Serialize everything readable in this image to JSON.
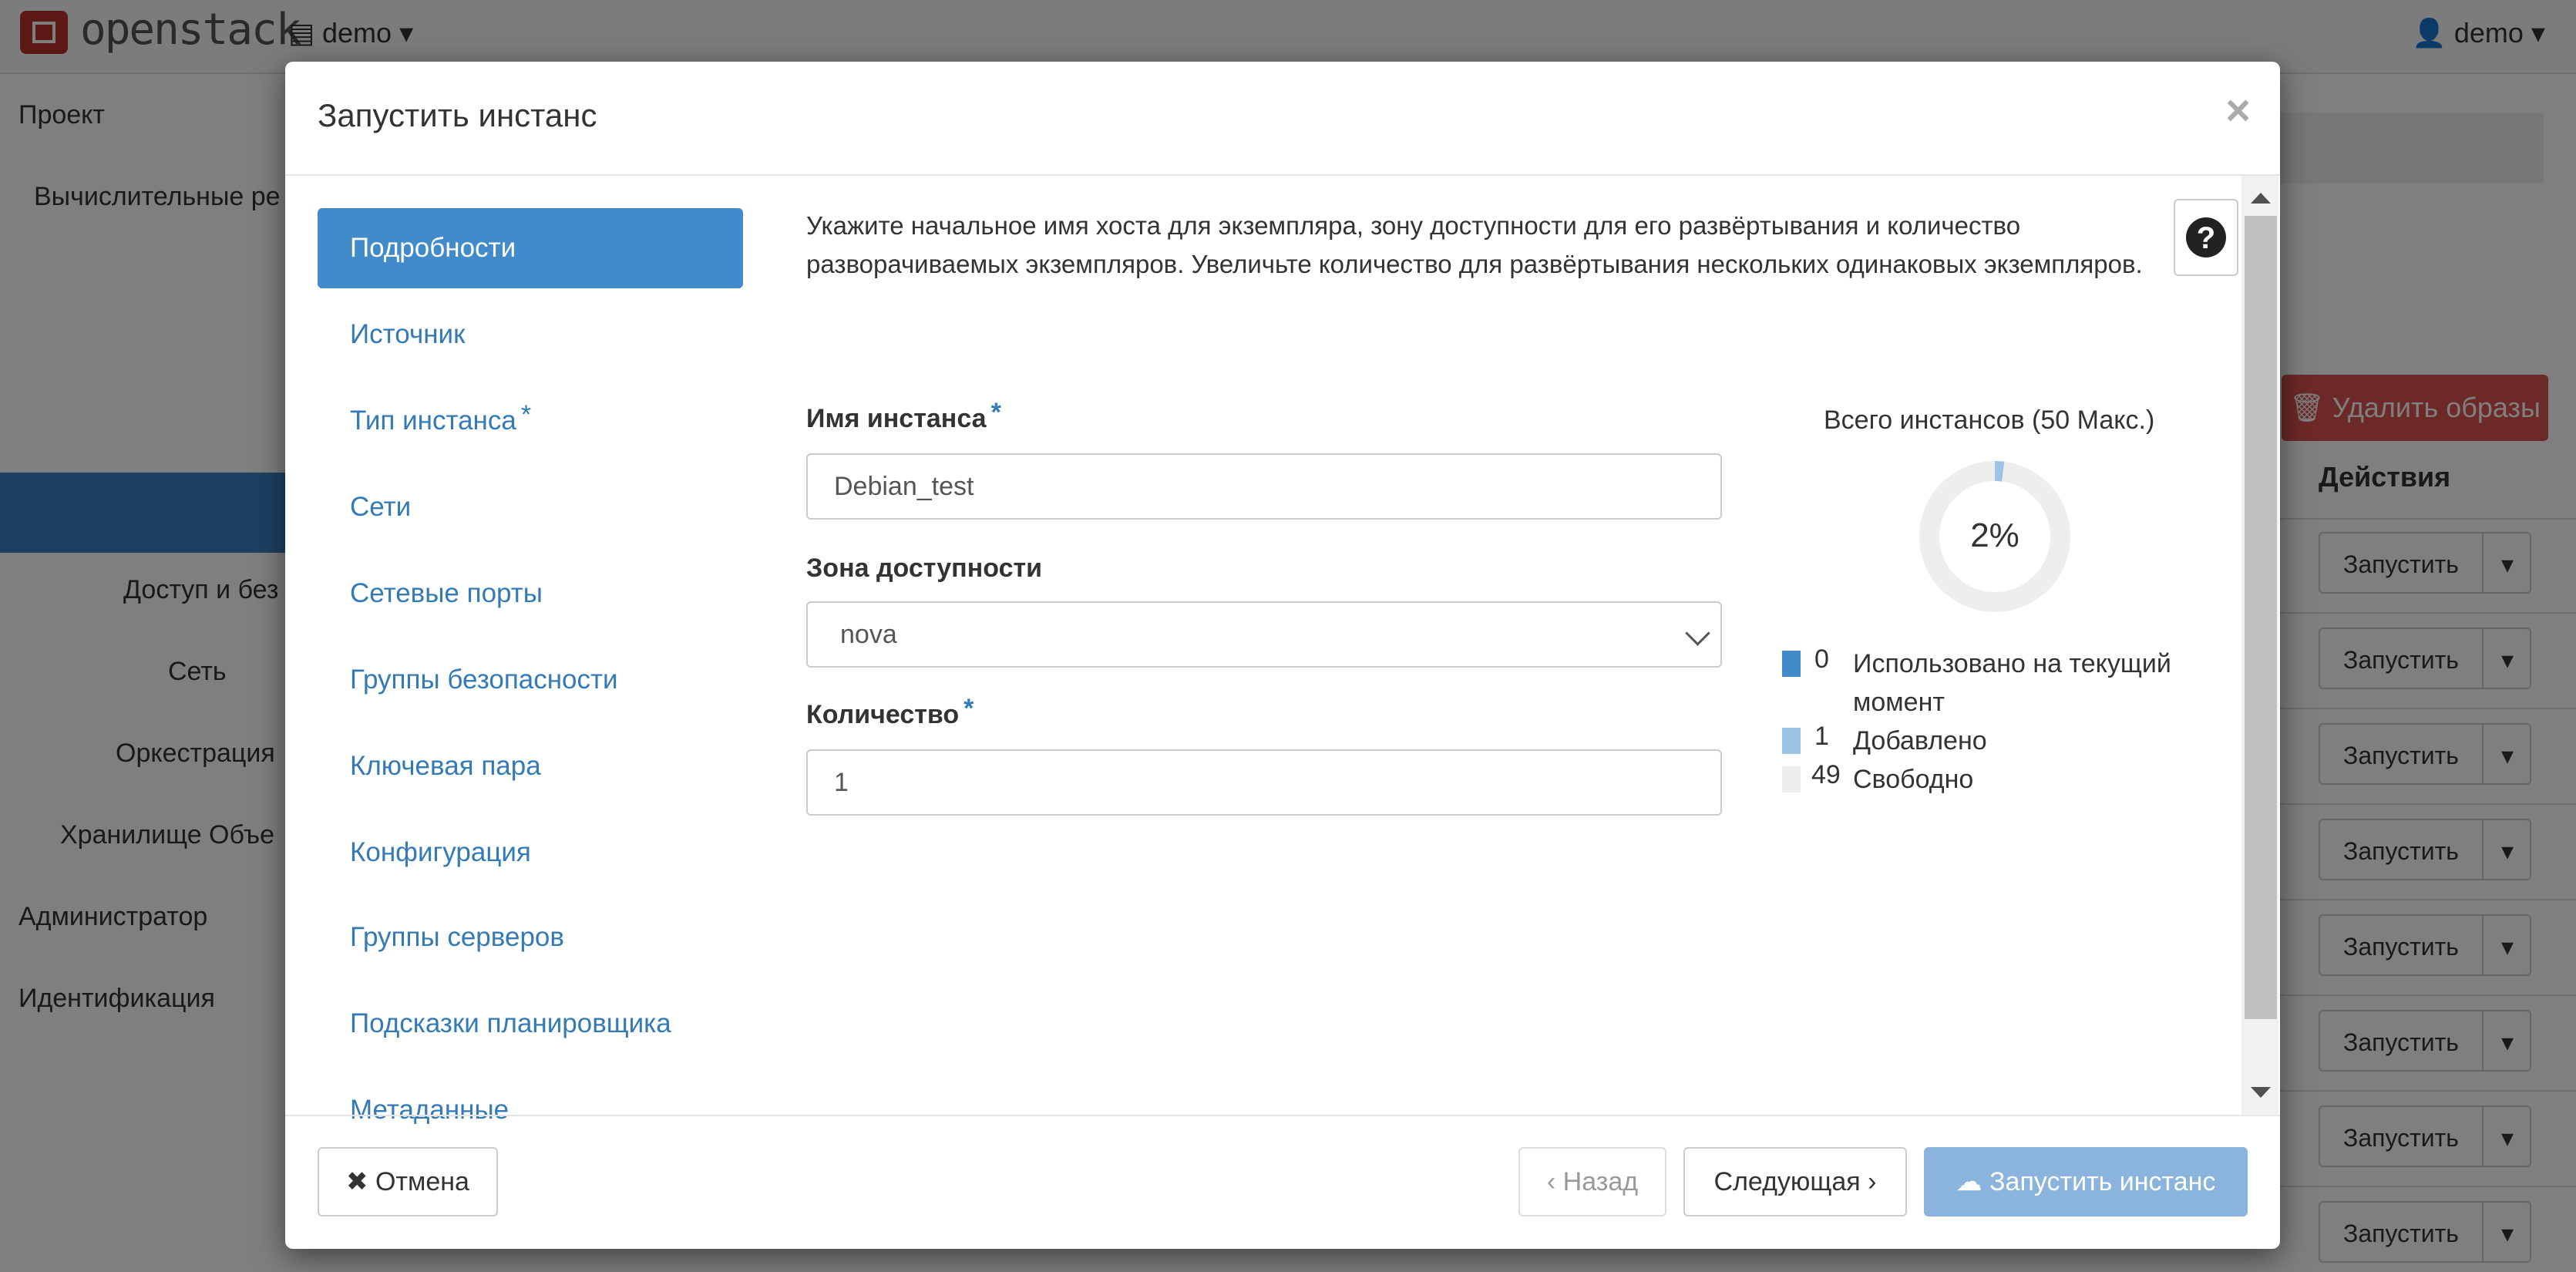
{
  "topbar": {
    "logo_text": "openstack",
    "project": "demo",
    "user": "demo"
  },
  "sidebar": {
    "items": [
      "Проект",
      "Вычислительные ре",
      "Доступ и без",
      "Сеть",
      "Оркестрация",
      "Хранилище Объе",
      "Администратор",
      "Идентификация"
    ]
  },
  "background": {
    "delete_button": "Удалить образы",
    "actions_header": "Действия",
    "row_action": "Запустить"
  },
  "modal": {
    "title": "Запустить инстанс",
    "close": "×",
    "nav": [
      {
        "label": "Подробности",
        "required": false,
        "active": true
      },
      {
        "label": "Источник",
        "required": false
      },
      {
        "label": "Тип инстанса",
        "required": true
      },
      {
        "label": "Сети",
        "required": false
      },
      {
        "label": "Сетевые порты",
        "required": false
      },
      {
        "label": "Группы безопасности",
        "required": false
      },
      {
        "label": "Ключевая пара",
        "required": false
      },
      {
        "label": "Конфигурация",
        "required": false
      },
      {
        "label": "Группы серверов",
        "required": false
      },
      {
        "label": "Подсказки планировщика",
        "required": false
      },
      {
        "label": "Метаданные",
        "required": false
      }
    ],
    "required_mark": "*",
    "description": "Укажите начальное имя хоста для экземпляра, зону доступности для его развёртывания и количество разворачиваемых экземпляров. Увеличьте количество для развёртывания нескольких одинаковых экземпляров.",
    "help_icon": "?",
    "fields": {
      "instance_name": {
        "label": "Имя инстанса",
        "value": "Debian_test"
      },
      "availability_zone": {
        "label": "Зона доступности",
        "value": "nova"
      },
      "count": {
        "label": "Количество",
        "value": "1"
      }
    },
    "quota": {
      "title": "Всего инстансов (50 Макс.)",
      "percent_label": "2%",
      "fraction_used": 0.02,
      "legend": [
        {
          "value": "0",
          "label": "Использовано на текущий момент",
          "color": "#428bca"
        },
        {
          "value": "1",
          "label": "Добавлено",
          "color": "#9cc3e6"
        },
        {
          "value": "49",
          "label": "Свободно",
          "color": "#eeeeee"
        }
      ]
    },
    "footer": {
      "cancel": "Отмена",
      "back": "Назад",
      "next": "Следующая",
      "launch": "Запустить инстанс"
    }
  },
  "colors": {
    "accent": "#428bca",
    "link": "#337ab7",
    "danger": "#d9534f"
  }
}
